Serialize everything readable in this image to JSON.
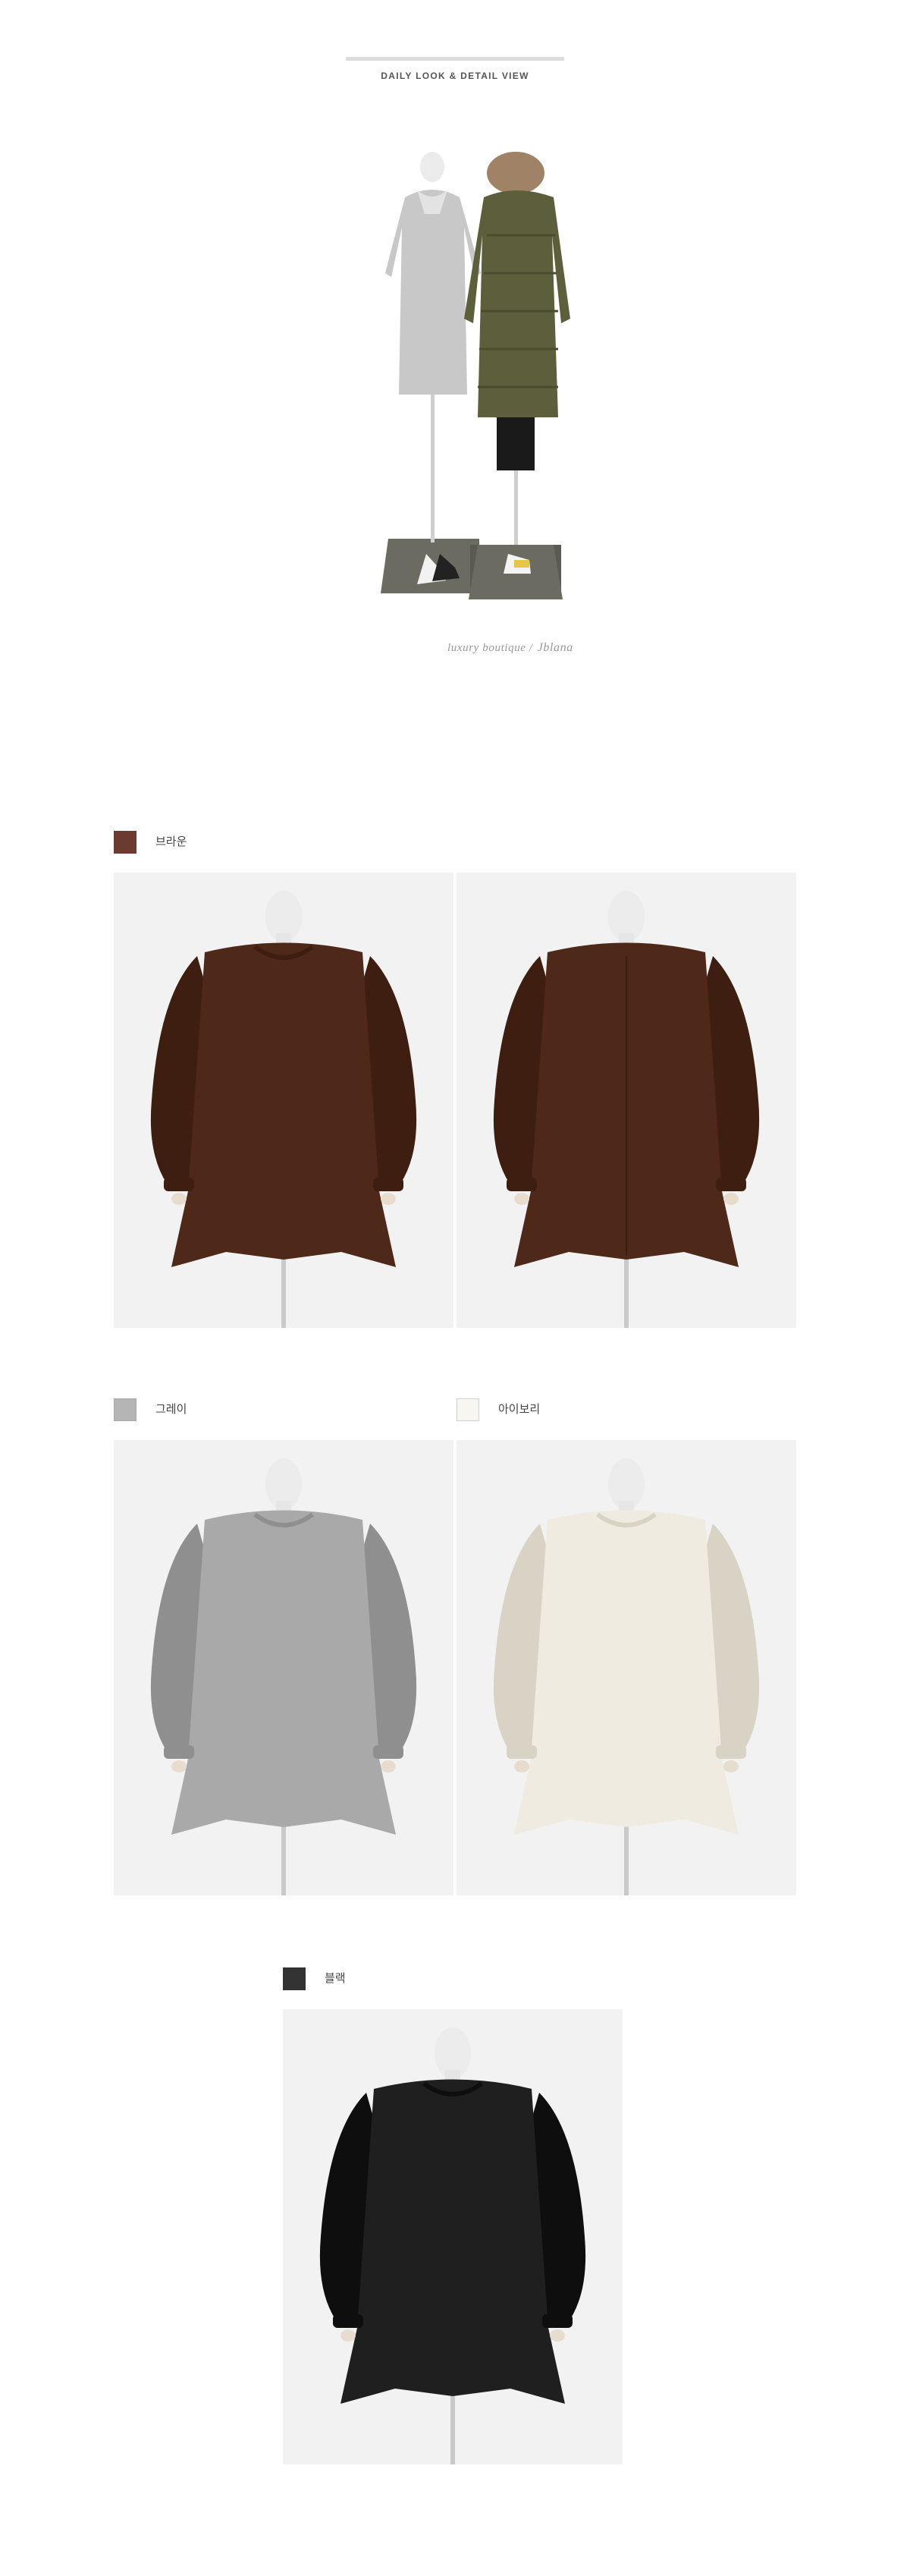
{
  "header": {
    "title": "DAILY LOOK & DETAIL VIEW"
  },
  "signature": {
    "brand_text": "luxury boutique /",
    "script_text": "Jblana"
  },
  "colors": [
    {
      "key": "brown",
      "label": "브라운",
      "swatch": "#6b3a30",
      "garment": "#4e2818",
      "garment_shade": "#3e1e10"
    },
    {
      "key": "gray",
      "label": "그레이",
      "swatch": "#b5b5b5",
      "garment": "#a9a9a9",
      "garment_shade": "#8f8f8f"
    },
    {
      "key": "ivory",
      "label": "아이보리",
      "swatch": "#f7f6f1",
      "garment": "#efebe1",
      "garment_shade": "#d9d3c6"
    },
    {
      "key": "black",
      "label": "블랙",
      "swatch": "#333333",
      "garment": "#1f1f1f",
      "garment_shade": "#0e0e0e"
    }
  ]
}
